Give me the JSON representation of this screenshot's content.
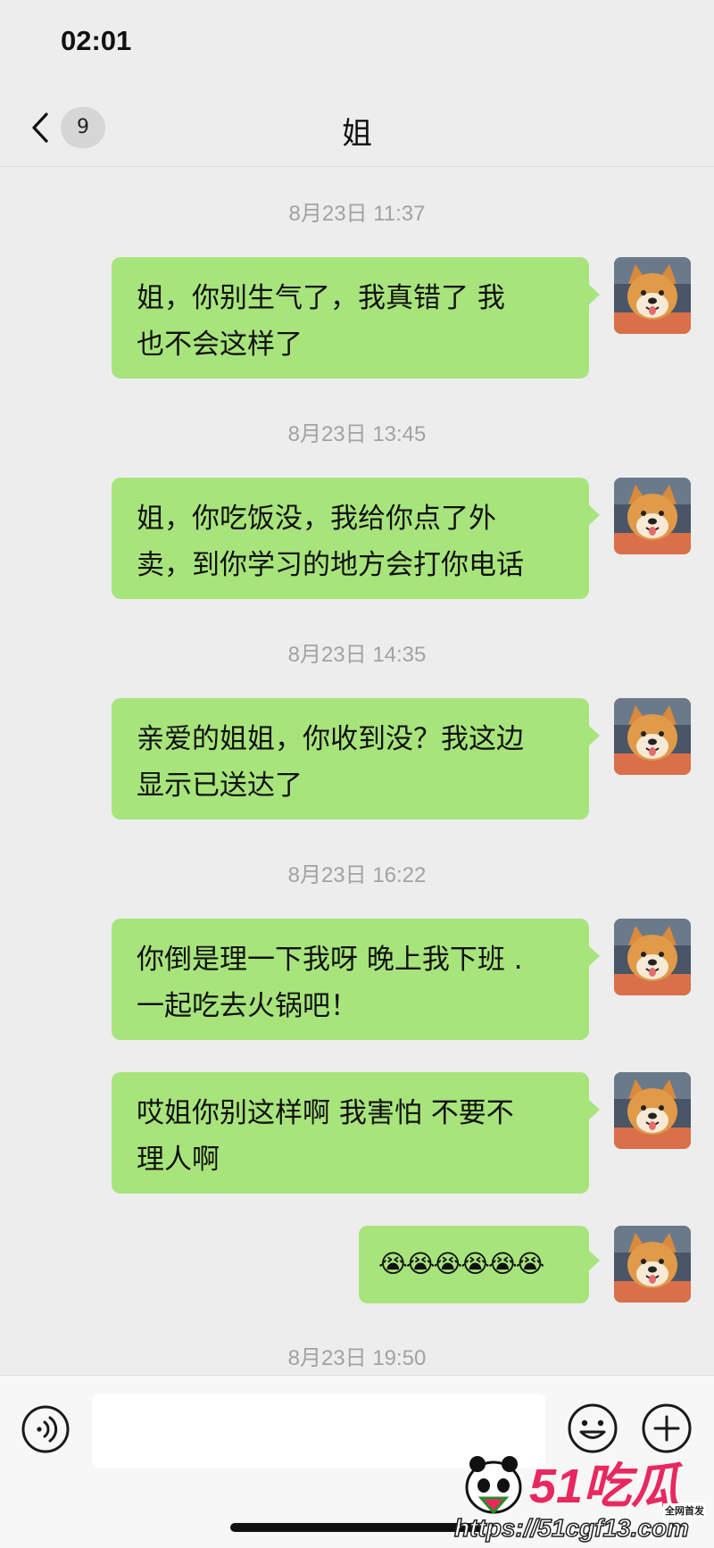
{
  "status": {
    "time": "02:01"
  },
  "nav": {
    "unread_count": "9",
    "title": "姐"
  },
  "messages": [
    {
      "timestamp": "8月23日 11:37",
      "lines": [
        "姐，你别生气了，我真错了 我",
        "也不会这样了"
      ]
    },
    {
      "timestamp": "8月23日 13:45",
      "lines": [
        "姐，你吃饭没，我给你点了外",
        "卖，到你学习的地方会打你电话"
      ]
    },
    {
      "timestamp": "8月23日 14:35",
      "lines": [
        "亲爱的姐姐，你收到没？我这边",
        "显示已送达了"
      ]
    },
    {
      "timestamp": "8月23日 16:22",
      "lines": [
        "你倒是理一下我呀 晚上我下班 .",
        "一起吃去火锅吧！"
      ]
    },
    {
      "timestamp": "",
      "lines": [
        "哎姐你别这样啊 我害怕 不要不",
        "理人啊"
      ]
    },
    {
      "timestamp": "",
      "lines": [
        "😭😭😭😭😭😭"
      ]
    }
  ],
  "last_timestamp": "8月23日 19:50",
  "input": {
    "value": "",
    "placeholder": ""
  },
  "icons": {
    "back": "chevron-left-icon",
    "voice": "voice-icon",
    "emoji": "emoji-icon",
    "plus": "plus-icon",
    "avatar": "shiba-dog-avatar"
  },
  "colors": {
    "bubble": "#a8e47c",
    "background": "#ededed",
    "timestamp": "#a2a2a2",
    "watermark_brand": "#e8285e"
  },
  "watermark": {
    "brand": "51吃瓜",
    "tag": "全网首发",
    "url": "https://51cgf13.com"
  }
}
